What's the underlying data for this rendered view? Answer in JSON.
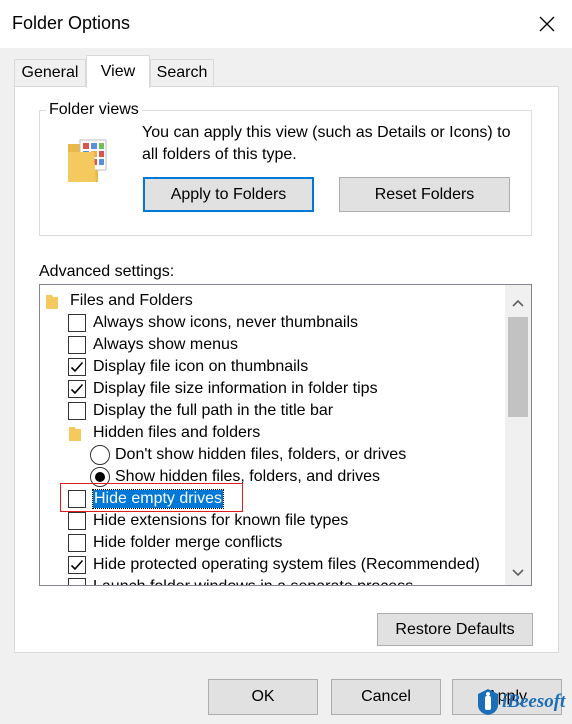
{
  "window": {
    "title": "Folder Options"
  },
  "tabs": [
    {
      "label": "General"
    },
    {
      "label": "View"
    },
    {
      "label": "Search"
    }
  ],
  "folder_views": {
    "group_label": "Folder views",
    "description": "You can apply this view (such as Details or Icons) to all folders of this type.",
    "apply_button": "Apply to Folders",
    "reset_button": "Reset Folders"
  },
  "advanced": {
    "label": "Advanced settings:",
    "items": [
      {
        "type": "folder",
        "label": "Files and Folders"
      },
      {
        "type": "checkbox",
        "checked": false,
        "label": "Always show icons, never thumbnails"
      },
      {
        "type": "checkbox",
        "checked": false,
        "label": "Always show menus"
      },
      {
        "type": "checkbox",
        "checked": true,
        "label": "Display file icon on thumbnails"
      },
      {
        "type": "checkbox",
        "checked": true,
        "label": "Display file size information in folder tips"
      },
      {
        "type": "checkbox",
        "checked": false,
        "label": "Display the full path in the title bar"
      },
      {
        "type": "folder",
        "label": "Hidden files and folders"
      },
      {
        "type": "radio",
        "checked": false,
        "label": "Don't show hidden files, folders, or drives"
      },
      {
        "type": "radio",
        "checked": true,
        "label": "Show hidden files, folders, and drives"
      },
      {
        "type": "checkbox",
        "checked": false,
        "label": "Hide empty drives"
      },
      {
        "type": "checkbox",
        "checked": false,
        "label": "Hide extensions for known file types"
      },
      {
        "type": "checkbox",
        "checked": false,
        "label": "Hide folder merge conflicts"
      },
      {
        "type": "checkbox",
        "checked": true,
        "label": "Hide protected operating system files (Recommended)"
      },
      {
        "type": "checkbox",
        "checked": false,
        "label": "Launch folder windows in a separate process"
      }
    ],
    "restore_button": "Restore Defaults"
  },
  "footer": {
    "ok": "OK",
    "cancel": "Cancel",
    "apply": "Apply"
  },
  "watermark": {
    "text": "iBeesoft"
  },
  "colors": {
    "accent": "#0078d7",
    "highlight_box": "#e31b1b",
    "folder": "#f4c95d"
  }
}
